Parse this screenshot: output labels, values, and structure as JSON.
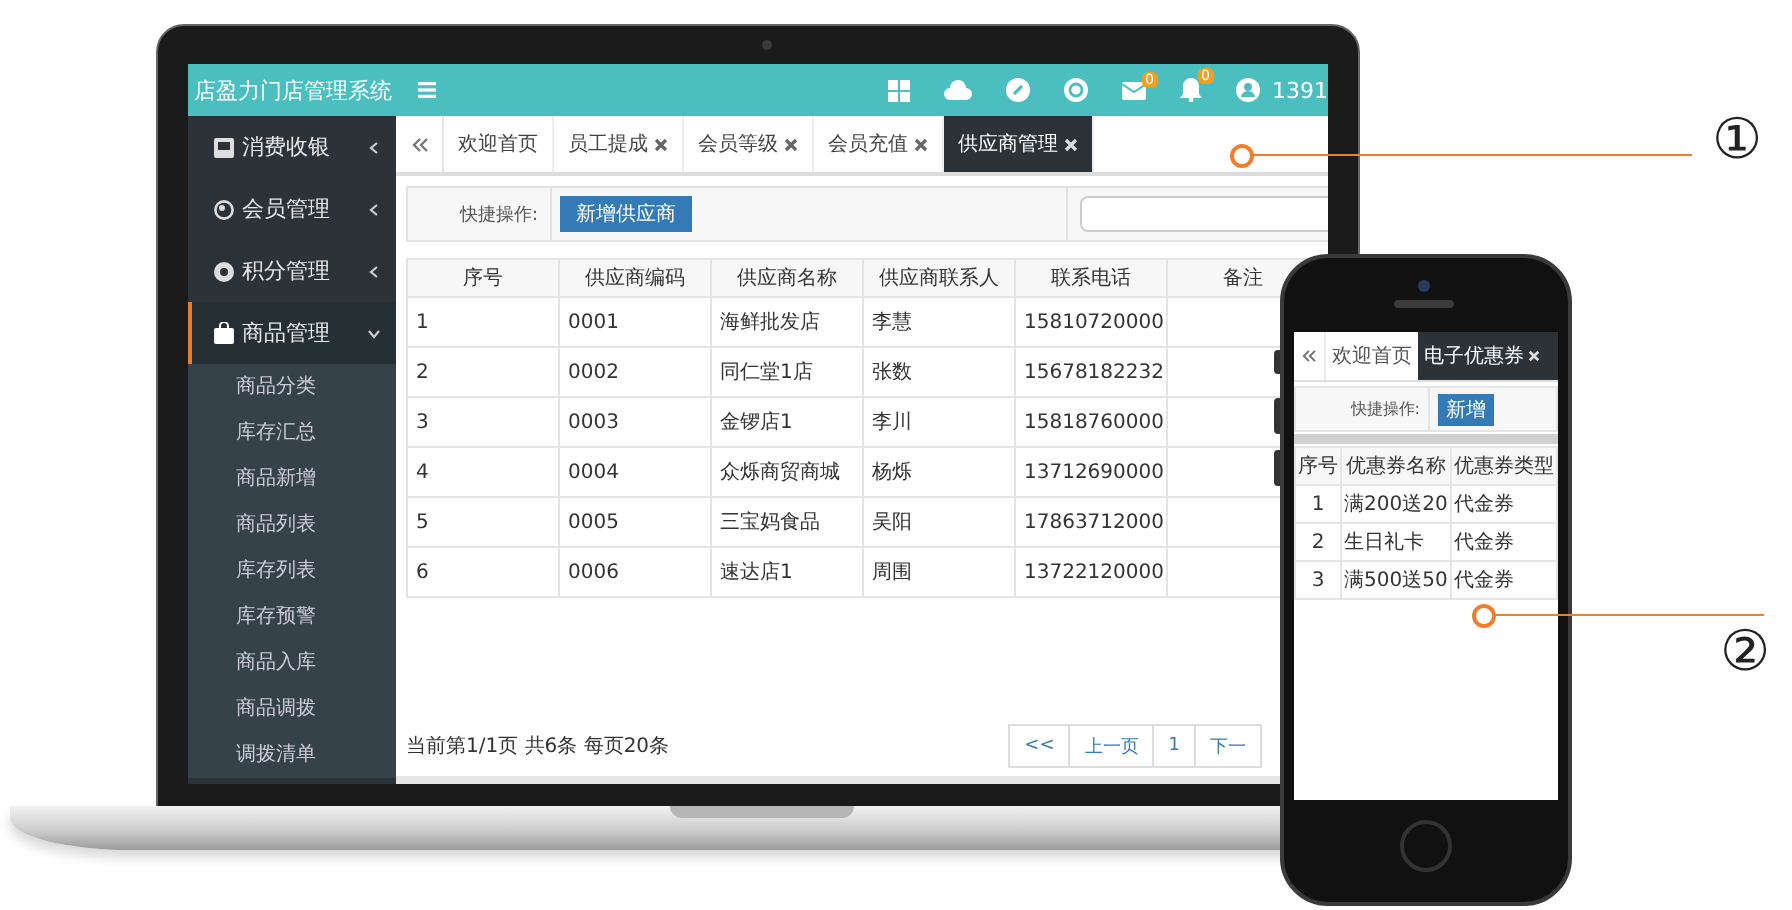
{
  "laptop": {
    "app_title": "店盈力门店管理系统",
    "mail_badge": "0",
    "bell_badge": "0",
    "user_name": "1391",
    "sidebar": {
      "items": [
        {
          "label": "消费收银",
          "expanded": false,
          "selected": false
        },
        {
          "label": "会员管理",
          "expanded": false,
          "selected": false
        },
        {
          "label": "积分管理",
          "expanded": false,
          "selected": false
        },
        {
          "label": "商品管理",
          "expanded": true,
          "selected": true,
          "children": [
            {
              "label": "商品分类"
            },
            {
              "label": "库存汇总"
            },
            {
              "label": "商品新增"
            },
            {
              "label": "商品列表"
            },
            {
              "label": "库存列表"
            },
            {
              "label": "库存预警"
            },
            {
              "label": "商品入库"
            },
            {
              "label": "商品调拨"
            },
            {
              "label": "调拨清单"
            }
          ]
        }
      ]
    },
    "tabs": [
      {
        "label": "欢迎首页",
        "closable": false,
        "selected": false
      },
      {
        "label": "员工提成",
        "closable": true,
        "selected": false
      },
      {
        "label": "会员等级",
        "closable": true,
        "selected": false
      },
      {
        "label": "会员充值",
        "closable": true,
        "selected": false
      },
      {
        "label": "供应商管理",
        "closable": true,
        "selected": true
      }
    ],
    "toolbar": {
      "label": "快捷操作:",
      "button": "新增供应商"
    },
    "table": {
      "columns": [
        "序号",
        "供应商编码",
        "供应商名称",
        "供应商联系人",
        "联系电话",
        "备注"
      ],
      "rows": [
        [
          "1",
          "0001",
          "海鲜批发店",
          "李慧",
          "15810720000"
        ],
        [
          "2",
          "0002",
          "同仁堂1店",
          "张数",
          "15678182232"
        ],
        [
          "3",
          "0003",
          "金锣店1",
          "李川",
          "15818760000"
        ],
        [
          "4",
          "0004",
          "众烁商贸商城",
          "杨烁",
          "13712690000"
        ],
        [
          "5",
          "0005",
          "三宝妈食品",
          "吴阳",
          "17863712000"
        ],
        [
          "6",
          "0006",
          "速达店1",
          "周围",
          "13722120000"
        ]
      ]
    },
    "footer": {
      "summary": "当前第1/1页 共6条 每页20条",
      "pagination": [
        "<<",
        "上一页",
        "1",
        "下一"
      ]
    }
  },
  "phone": {
    "tabs": [
      {
        "label": "欢迎首页",
        "closable": false,
        "selected": false
      },
      {
        "label": "电子优惠券",
        "closable": true,
        "selected": true
      }
    ],
    "toolbar": {
      "label": "快捷操作:",
      "button": "新增"
    },
    "table": {
      "columns": [
        "序号",
        "优惠券名称",
        "优惠券类型"
      ],
      "rows": [
        [
          "1",
          "满200送20",
          "代金券"
        ],
        [
          "2",
          "生日礼卡",
          "代金券"
        ],
        [
          "3",
          "满500送50",
          "代金券"
        ]
      ]
    }
  },
  "callouts": [
    "①",
    "②"
  ]
}
